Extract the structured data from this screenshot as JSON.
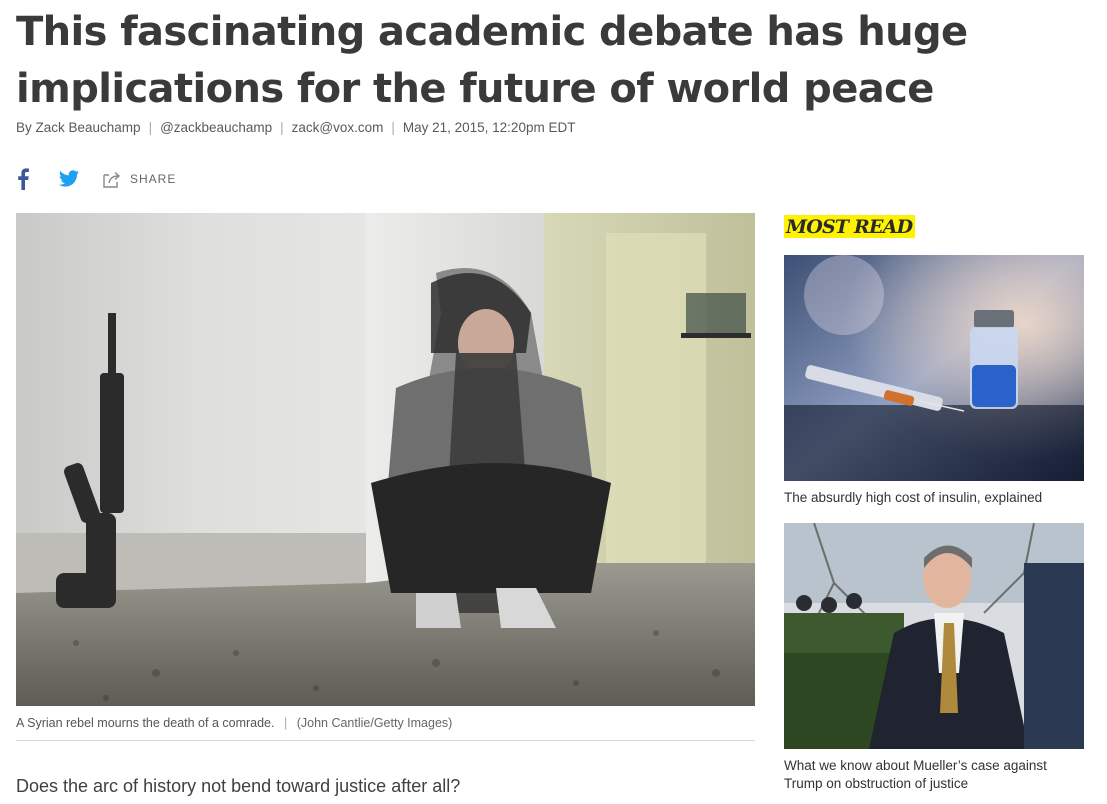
{
  "article": {
    "headline_line1": "This fascinating academic debate has huge",
    "headline_line2": "implications for the future of world peace",
    "byline": {
      "author": "By Zack Beauchamp",
      "twitter": "@zackbeauchamp",
      "email": "zack@vox.com",
      "date": "May 21, 2015, 12:20pm EDT"
    },
    "share": {
      "facebook_icon": "facebook-icon",
      "twitter_icon": "twitter-icon",
      "share_label": "SHARE"
    },
    "image": {
      "caption": "A Syrian rebel mourns the death of a comrade.",
      "credit": "(John Cantlie/Getty Images)"
    },
    "lede": "Does the arc of history not bend toward justice after all?"
  },
  "most_read": {
    "title": "MOST READ",
    "items": [
      {
        "title": "The absurdly high cost of insulin, explained"
      },
      {
        "title": "What we know about Mueller’s case against Trump on obstruction of justice"
      }
    ]
  },
  "colors": {
    "headline": "#3a3a3a",
    "facebook": "#3b5998",
    "twitter": "#1da1f2",
    "most_read_highlight": "#fff200"
  }
}
